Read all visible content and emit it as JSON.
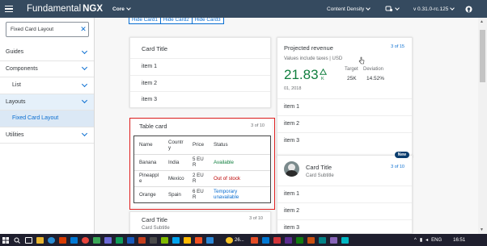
{
  "header": {
    "brand": "Fundamental",
    "brand_accent": "NGX",
    "core_select": "Core",
    "content_density": "Content Density",
    "version": "v 0.31.0-rc.125"
  },
  "sidebar": {
    "search_value": "Fixed Card Layout",
    "items": [
      {
        "label": "Guides"
      },
      {
        "label": "Components"
      },
      {
        "label": "List"
      },
      {
        "label": "Layouts"
      },
      {
        "label": "Fixed Card Layout"
      },
      {
        "label": "Utilities"
      }
    ]
  },
  "toolbar": {
    "hide_buttons": [
      "Hide Card1",
      "Hide Card2",
      "Hide Card3"
    ]
  },
  "card1": {
    "title": "Card Title",
    "items": [
      "item 1",
      "item 2",
      "item 3"
    ]
  },
  "table_card": {
    "title": "Table card",
    "counter": "3 of 10",
    "columns": [
      "Name",
      "Countr\ny",
      "Price",
      "Status"
    ],
    "rows": [
      {
        "name": "Banana",
        "country": "India",
        "price": "5 EU\nR",
        "status": "Available",
        "status_color": "#107e3e"
      },
      {
        "name": "Pineappl\ne",
        "country": "Mexico",
        "price": "2 EU\nR",
        "status": "Out of stock",
        "status_color": "#bb0000"
      },
      {
        "name": "Orange",
        "country": "Spain",
        "price": "6 EU\nR",
        "status": "Temporary\nunavailable",
        "status_color": "#0a6ed1"
      }
    ]
  },
  "card3": {
    "title": "Card Title",
    "counter": "3 of 10",
    "subtitle": "Card Subtitle"
  },
  "projected": {
    "title": "Projected revenue",
    "counter": "3 of 15",
    "subtitle": "Values include taxes | USD",
    "value": "21.83",
    "unit": "K",
    "target_label": "Target",
    "target_value": "25K",
    "deviation_label": "Deviation",
    "deviation_value": "14.52%",
    "date": "01, 2018",
    "items": [
      "item 1",
      "item 2",
      "item 3"
    ]
  },
  "profile_card": {
    "badge": "New",
    "title": "Card Title",
    "subtitle": "Card Subtitle",
    "counter": "3 of 10",
    "items": [
      "item 1",
      "item 2",
      "item 3"
    ]
  },
  "taskbar": {
    "weather": "26...",
    "lang": "ENG",
    "time": "16:51"
  },
  "colors": {
    "shell": "#354a5f",
    "accent": "#0a6ed1",
    "positive": "#107e3e",
    "negative": "#bb0000",
    "highlight_border": "#e02020"
  }
}
